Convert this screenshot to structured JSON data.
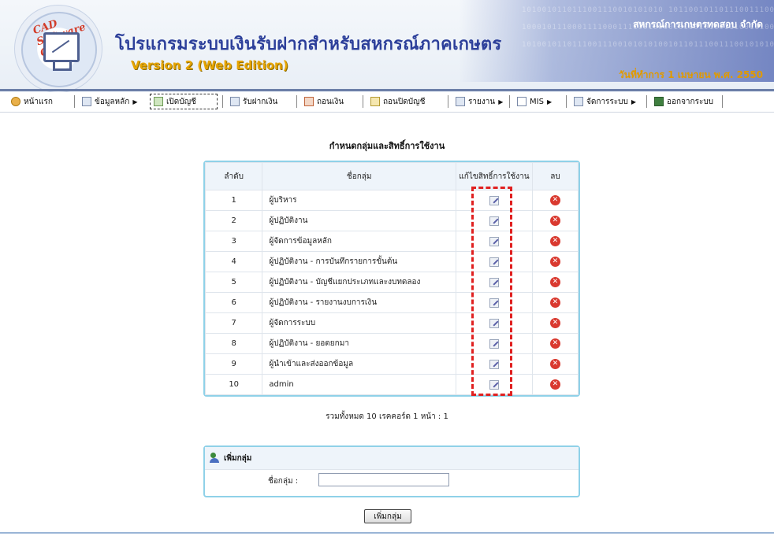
{
  "header": {
    "logo_text": "CAD Software Center",
    "title": "โปรแกรมระบบเงินรับฝากสำหรับสหกรณ์ภาคเกษตร",
    "version": "Version 2 (Web Edition)",
    "org_name": "สหกรณ์การเกษตรทดสอบ จำกัด",
    "work_date": "วันที่ทำการ 1 เมษายน พ.ศ. 2550"
  },
  "menu": [
    {
      "label": "หน้าแรก",
      "icon": "home-icon"
    },
    {
      "label": "ข้อมูลหลัก",
      "icon": "folder-icon",
      "has_submenu": true
    },
    {
      "label": "เปิดบัญชี",
      "icon": "open-account-icon",
      "selected": true
    },
    {
      "label": "รับฝากเงิน",
      "icon": "deposit-icon"
    },
    {
      "label": "ถอนเงิน",
      "icon": "withdraw-icon"
    },
    {
      "label": "ถอนปิดบัญชี",
      "icon": "close-account-icon"
    },
    {
      "label": "รายงาน",
      "icon": "report-icon",
      "has_submenu": true
    },
    {
      "label": "MIS",
      "icon": "mis-icon",
      "has_submenu": true
    },
    {
      "label": "จัดการระบบ",
      "icon": "system-icon",
      "has_submenu": true
    },
    {
      "label": "ออกจากระบบ",
      "icon": "logout-icon"
    }
  ],
  "page": {
    "heading": "กำหนดกลุ่มและสิทธิ์การใช้งาน"
  },
  "table": {
    "columns": [
      "ลำดับ",
      "ชื่อกลุ่ม",
      "แก้ไขสิทธิ์การใช้งาน",
      "ลบ"
    ],
    "rows": [
      {
        "no": "1",
        "name": "ผู้บริหาร"
      },
      {
        "no": "2",
        "name": "ผู้ปฏิบัติงาน"
      },
      {
        "no": "3",
        "name": "ผู้จัดการข้อมูลหลัก"
      },
      {
        "no": "4",
        "name": "ผู้ปฏิบัติงาน - การบันทึกรายการขั้นต้น"
      },
      {
        "no": "5",
        "name": "ผู้ปฏิบัติงาน - บัญชีแยกประเภทและงบทดลอง"
      },
      {
        "no": "6",
        "name": "ผู้ปฏิบัติงาน - รายงานงบการเงิน"
      },
      {
        "no": "7",
        "name": "ผู้จัดการระบบ"
      },
      {
        "no": "8",
        "name": "ผู้ปฏิบัติงาน - ยอดยกมา"
      },
      {
        "no": "9",
        "name": "ผู้นำเข้าและส่งออกข้อมูล"
      },
      {
        "no": "10",
        "name": "admin"
      }
    ]
  },
  "summary": "รวมทั้งหมด 10 เรคคอร์ด 1 หน้า : 1",
  "add_group": {
    "title": "เพิ่มกลุ่ม",
    "field_label": "ชื่อกลุ่ม :",
    "field_value": "",
    "button_label": "เพิ่มกลุ่ม"
  },
  "colors": {
    "title": "#2c3f9a",
    "version": "#e6a400",
    "table_border": "#8fd1e8",
    "highlight_box": "#e02020",
    "delete_icon": "#d9392f"
  }
}
